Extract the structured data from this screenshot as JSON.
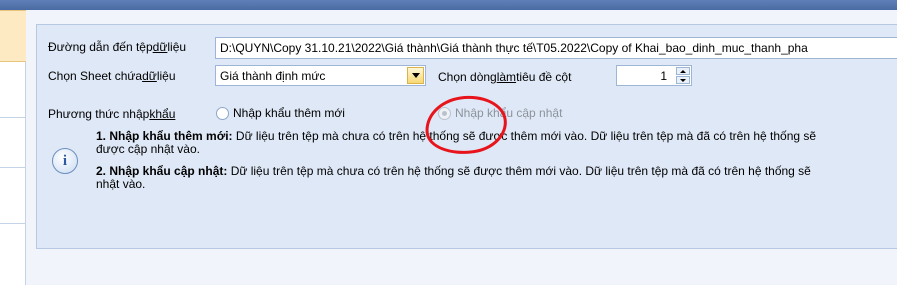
{
  "form": {
    "path_label_pre": "Đường dẫn đến tệp ",
    "path_label_u": "dữ",
    "path_label_post": " liệu",
    "path_value": "D:\\QUYN\\Copy 31.10.21\\2022\\Giá thành\\Giá thành thực tế\\T05.2022\\Copy of Khai_bao_dinh_muc_thanh_pha",
    "sheet_label_pre": "Chọn Sheet chứa ",
    "sheet_label_u": "dữ",
    "sheet_label_post": " liệu",
    "sheet_value": "Giá thành định mức",
    "header_row_label_pre": "Chọn dòng ",
    "header_row_label_u": "làm",
    "header_row_label_post": " tiêu đề cột",
    "header_row_value": "1",
    "method_label_pre": "Phương thức nhập ",
    "method_label_u": "khẩu",
    "option_add_new": "Nhập khẩu thêm mới",
    "option_update": "Nhập khẩu cập nhật"
  },
  "notes": {
    "note1_title": "1. Nhập khẩu thêm mới:",
    "note1_line1": " Dữ liệu trên tệp mà chưa có trên hệ thống sẽ được thêm mới vào. Dữ liệu trên tệp mà đã có trên hệ thống sẽ",
    "note1_line2": "được cập nhật vào.",
    "note2_title": "2. Nhập khẩu cập nhật:",
    "note2_line1": " Dữ liệu trên tệp mà chưa có trên hệ thống sẽ được thêm mới vào. Dữ liệu trên tệp mà đã có trên hệ thống sẽ",
    "note2_line2": "nhật vào."
  },
  "icons": {
    "info": "i"
  },
  "colors": {
    "annotation_circle": "#e8141c",
    "panel_bg": "#dfe8f6",
    "topbar": "#4a6aa3"
  }
}
